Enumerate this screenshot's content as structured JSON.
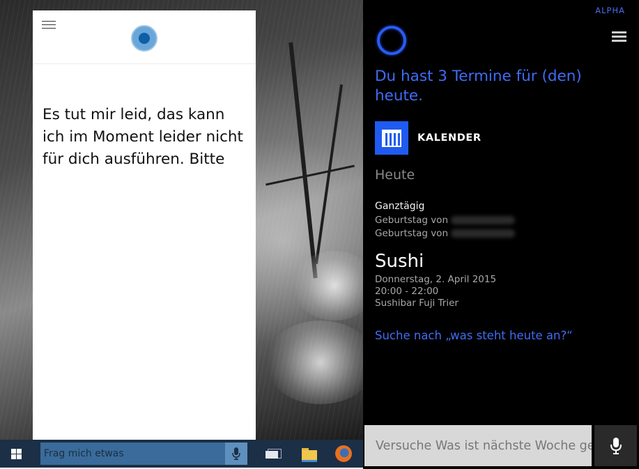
{
  "cortana_pc": {
    "message": "Es tut mir leid, das kann ich im Moment leider nicht für dich ausführen. Bitte"
  },
  "taskbar": {
    "search_placeholder": "Frag mich etwas",
    "icons": [
      "windows-start-icon",
      "microphone-icon",
      "task-view-icon",
      "file-explorer-icon",
      "firefox-icon"
    ]
  },
  "phone": {
    "badge": "ALPHA",
    "headline": "Du hast 3 Termine für (den) heute.",
    "app_label": "KALENDER",
    "day_heading": "Heute",
    "all_day_title": "Ganztägig",
    "birthdays": [
      "Geburtstag von",
      "Geburtstag von"
    ],
    "event": {
      "title": "Sushi",
      "date": "Donnerstag, 2. April 2015",
      "time": "20:00 - 22:00",
      "location": "Sushibar Fuji Trier"
    },
    "search_suggestion": "Suche nach „was steht heute an?“",
    "input_placeholder": "Versuche Was ist nächste Woche geplant?"
  },
  "colors": {
    "accent_blue": "#3f6cf5",
    "taskbar": "#1b2f46",
    "search_box": "#3a6b9a"
  }
}
